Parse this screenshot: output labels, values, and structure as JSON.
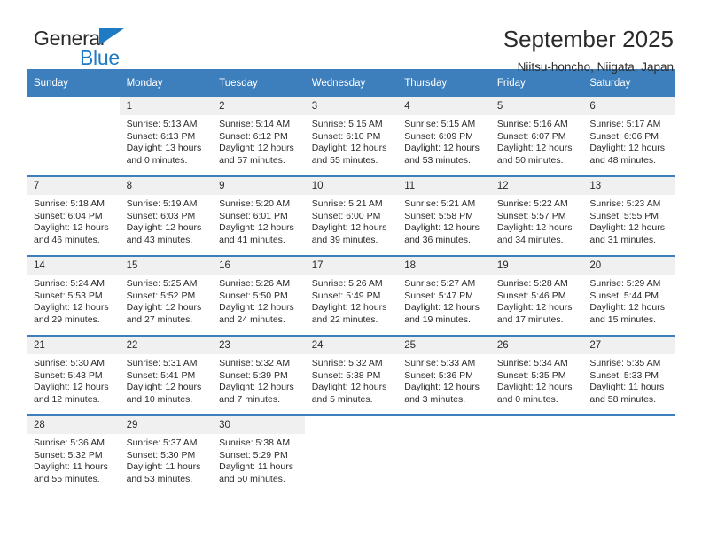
{
  "brand": {
    "name_part1": "General",
    "name_part2": "Blue",
    "triangle_color": "#1f7ac4"
  },
  "header": {
    "title": "September 2025",
    "subtitle": "Niitsu-honcho, Niigata, Japan"
  },
  "theme": {
    "header_bg": "#3d7ebd",
    "daynum_bg": "#f0f0f0",
    "text": "#2b2b2b",
    "accent": "#1f7ac4"
  },
  "calendar": {
    "weekday_headers": [
      "Sunday",
      "Monday",
      "Tuesday",
      "Wednesday",
      "Thursday",
      "Friday",
      "Saturday"
    ],
    "labels": {
      "sunrise": "Sunrise:",
      "sunset": "Sunset:",
      "daylight": "Daylight:"
    },
    "weeks": [
      [
        {
          "day": "",
          "blank": true,
          "sunrise": "",
          "sunset": "",
          "daylight_line1": "",
          "daylight_line2": ""
        },
        {
          "day": "1",
          "blank": false,
          "sunrise": "Sunrise: 5:13 AM",
          "sunset": "Sunset: 6:13 PM",
          "daylight_line1": "Daylight: 13 hours",
          "daylight_line2": "and 0 minutes."
        },
        {
          "day": "2",
          "blank": false,
          "sunrise": "Sunrise: 5:14 AM",
          "sunset": "Sunset: 6:12 PM",
          "daylight_line1": "Daylight: 12 hours",
          "daylight_line2": "and 57 minutes."
        },
        {
          "day": "3",
          "blank": false,
          "sunrise": "Sunrise: 5:15 AM",
          "sunset": "Sunset: 6:10 PM",
          "daylight_line1": "Daylight: 12 hours",
          "daylight_line2": "and 55 minutes."
        },
        {
          "day": "4",
          "blank": false,
          "sunrise": "Sunrise: 5:15 AM",
          "sunset": "Sunset: 6:09 PM",
          "daylight_line1": "Daylight: 12 hours",
          "daylight_line2": "and 53 minutes."
        },
        {
          "day": "5",
          "blank": false,
          "sunrise": "Sunrise: 5:16 AM",
          "sunset": "Sunset: 6:07 PM",
          "daylight_line1": "Daylight: 12 hours",
          "daylight_line2": "and 50 minutes."
        },
        {
          "day": "6",
          "blank": false,
          "sunrise": "Sunrise: 5:17 AM",
          "sunset": "Sunset: 6:06 PM",
          "daylight_line1": "Daylight: 12 hours",
          "daylight_line2": "and 48 minutes."
        }
      ],
      [
        {
          "day": "7",
          "blank": false,
          "sunrise": "Sunrise: 5:18 AM",
          "sunset": "Sunset: 6:04 PM",
          "daylight_line1": "Daylight: 12 hours",
          "daylight_line2": "and 46 minutes."
        },
        {
          "day": "8",
          "blank": false,
          "sunrise": "Sunrise: 5:19 AM",
          "sunset": "Sunset: 6:03 PM",
          "daylight_line1": "Daylight: 12 hours",
          "daylight_line2": "and 43 minutes."
        },
        {
          "day": "9",
          "blank": false,
          "sunrise": "Sunrise: 5:20 AM",
          "sunset": "Sunset: 6:01 PM",
          "daylight_line1": "Daylight: 12 hours",
          "daylight_line2": "and 41 minutes."
        },
        {
          "day": "10",
          "blank": false,
          "sunrise": "Sunrise: 5:21 AM",
          "sunset": "Sunset: 6:00 PM",
          "daylight_line1": "Daylight: 12 hours",
          "daylight_line2": "and 39 minutes."
        },
        {
          "day": "11",
          "blank": false,
          "sunrise": "Sunrise: 5:21 AM",
          "sunset": "Sunset: 5:58 PM",
          "daylight_line1": "Daylight: 12 hours",
          "daylight_line2": "and 36 minutes."
        },
        {
          "day": "12",
          "blank": false,
          "sunrise": "Sunrise: 5:22 AM",
          "sunset": "Sunset: 5:57 PM",
          "daylight_line1": "Daylight: 12 hours",
          "daylight_line2": "and 34 minutes."
        },
        {
          "day": "13",
          "blank": false,
          "sunrise": "Sunrise: 5:23 AM",
          "sunset": "Sunset: 5:55 PM",
          "daylight_line1": "Daylight: 12 hours",
          "daylight_line2": "and 31 minutes."
        }
      ],
      [
        {
          "day": "14",
          "blank": false,
          "sunrise": "Sunrise: 5:24 AM",
          "sunset": "Sunset: 5:53 PM",
          "daylight_line1": "Daylight: 12 hours",
          "daylight_line2": "and 29 minutes."
        },
        {
          "day": "15",
          "blank": false,
          "sunrise": "Sunrise: 5:25 AM",
          "sunset": "Sunset: 5:52 PM",
          "daylight_line1": "Daylight: 12 hours",
          "daylight_line2": "and 27 minutes."
        },
        {
          "day": "16",
          "blank": false,
          "sunrise": "Sunrise: 5:26 AM",
          "sunset": "Sunset: 5:50 PM",
          "daylight_line1": "Daylight: 12 hours",
          "daylight_line2": "and 24 minutes."
        },
        {
          "day": "17",
          "blank": false,
          "sunrise": "Sunrise: 5:26 AM",
          "sunset": "Sunset: 5:49 PM",
          "daylight_line1": "Daylight: 12 hours",
          "daylight_line2": "and 22 minutes."
        },
        {
          "day": "18",
          "blank": false,
          "sunrise": "Sunrise: 5:27 AM",
          "sunset": "Sunset: 5:47 PM",
          "daylight_line1": "Daylight: 12 hours",
          "daylight_line2": "and 19 minutes."
        },
        {
          "day": "19",
          "blank": false,
          "sunrise": "Sunrise: 5:28 AM",
          "sunset": "Sunset: 5:46 PM",
          "daylight_line1": "Daylight: 12 hours",
          "daylight_line2": "and 17 minutes."
        },
        {
          "day": "20",
          "blank": false,
          "sunrise": "Sunrise: 5:29 AM",
          "sunset": "Sunset: 5:44 PM",
          "daylight_line1": "Daylight: 12 hours",
          "daylight_line2": "and 15 minutes."
        }
      ],
      [
        {
          "day": "21",
          "blank": false,
          "sunrise": "Sunrise: 5:30 AM",
          "sunset": "Sunset: 5:43 PM",
          "daylight_line1": "Daylight: 12 hours",
          "daylight_line2": "and 12 minutes."
        },
        {
          "day": "22",
          "blank": false,
          "sunrise": "Sunrise: 5:31 AM",
          "sunset": "Sunset: 5:41 PM",
          "daylight_line1": "Daylight: 12 hours",
          "daylight_line2": "and 10 minutes."
        },
        {
          "day": "23",
          "blank": false,
          "sunrise": "Sunrise: 5:32 AM",
          "sunset": "Sunset: 5:39 PM",
          "daylight_line1": "Daylight: 12 hours",
          "daylight_line2": "and 7 minutes."
        },
        {
          "day": "24",
          "blank": false,
          "sunrise": "Sunrise: 5:32 AM",
          "sunset": "Sunset: 5:38 PM",
          "daylight_line1": "Daylight: 12 hours",
          "daylight_line2": "and 5 minutes."
        },
        {
          "day": "25",
          "blank": false,
          "sunrise": "Sunrise: 5:33 AM",
          "sunset": "Sunset: 5:36 PM",
          "daylight_line1": "Daylight: 12 hours",
          "daylight_line2": "and 3 minutes."
        },
        {
          "day": "26",
          "blank": false,
          "sunrise": "Sunrise: 5:34 AM",
          "sunset": "Sunset: 5:35 PM",
          "daylight_line1": "Daylight: 12 hours",
          "daylight_line2": "and 0 minutes."
        },
        {
          "day": "27",
          "blank": false,
          "sunrise": "Sunrise: 5:35 AM",
          "sunset": "Sunset: 5:33 PM",
          "daylight_line1": "Daylight: 11 hours",
          "daylight_line2": "and 58 minutes."
        }
      ],
      [
        {
          "day": "28",
          "blank": false,
          "sunrise": "Sunrise: 5:36 AM",
          "sunset": "Sunset: 5:32 PM",
          "daylight_line1": "Daylight: 11 hours",
          "daylight_line2": "and 55 minutes."
        },
        {
          "day": "29",
          "blank": false,
          "sunrise": "Sunrise: 5:37 AM",
          "sunset": "Sunset: 5:30 PM",
          "daylight_line1": "Daylight: 11 hours",
          "daylight_line2": "and 53 minutes."
        },
        {
          "day": "30",
          "blank": false,
          "sunrise": "Sunrise: 5:38 AM",
          "sunset": "Sunset: 5:29 PM",
          "daylight_line1": "Daylight: 11 hours",
          "daylight_line2": "and 50 minutes."
        },
        {
          "day": "",
          "blank": true,
          "sunrise": "",
          "sunset": "",
          "daylight_line1": "",
          "daylight_line2": ""
        },
        {
          "day": "",
          "blank": true,
          "sunrise": "",
          "sunset": "",
          "daylight_line1": "",
          "daylight_line2": ""
        },
        {
          "day": "",
          "blank": true,
          "sunrise": "",
          "sunset": "",
          "daylight_line1": "",
          "daylight_line2": ""
        },
        {
          "day": "",
          "blank": true,
          "sunrise": "",
          "sunset": "",
          "daylight_line1": "",
          "daylight_line2": ""
        }
      ]
    ]
  }
}
